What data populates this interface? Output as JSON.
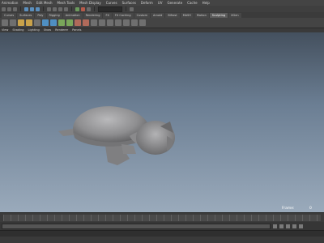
{
  "menubar": {
    "items": [
      "Animation",
      "Mesh",
      "Edit Mesh",
      "Mesh Tools",
      "Mesh Display",
      "Curves",
      "Surfaces",
      "Deform",
      "UV",
      "Generate",
      "Cache",
      "Help"
    ]
  },
  "shelf": {
    "tabs": [
      "Curves",
      "Surfaces",
      "Poly",
      "Rigging",
      "Animation",
      "Rendering",
      "FX",
      "FX Caching",
      "Custom",
      "Arnold",
      "Bifrost",
      "MASH",
      "Motion",
      "Sculpting",
      "XGen"
    ],
    "active_tab": "Sculpting"
  },
  "panel_menu": {
    "items": [
      "View",
      "Shading",
      "Lighting",
      "Show",
      "Renderer",
      "Panels"
    ]
  },
  "viewport": {
    "frame_label": "Frame:",
    "frame_value": "0"
  }
}
